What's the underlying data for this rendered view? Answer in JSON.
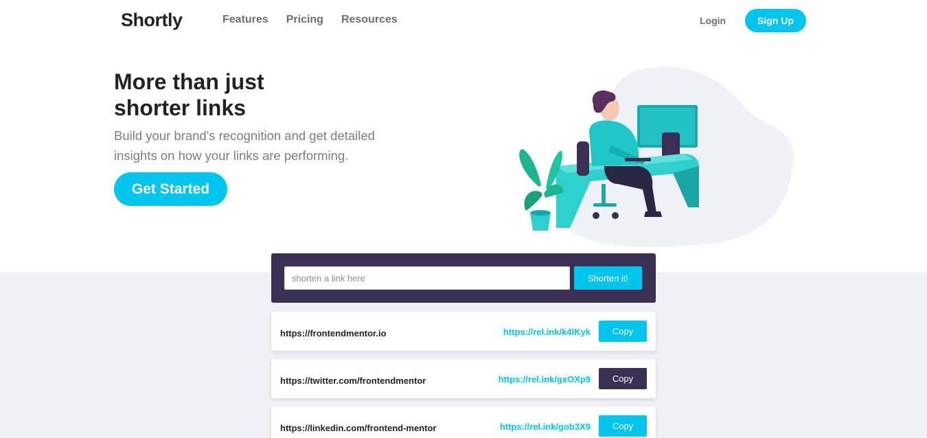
{
  "brand": {
    "name": "Shortly"
  },
  "nav": {
    "items": [
      "Features",
      "Pricing",
      "Resources"
    ]
  },
  "auth": {
    "login_label": "Login",
    "signup_label": "Sign Up"
  },
  "hero": {
    "title_line1": "More than just",
    "title_line2": "shorter links",
    "subtitle_line1": "Build your brand's recognition and get detailed",
    "subtitle_line2": "insights on how your links are performing.",
    "cta_label": "Get Started"
  },
  "shorten": {
    "placeholder": "shorten a link here",
    "button_label": "Shorten it!"
  },
  "results": [
    {
      "original": "https://frontendmentor.io",
      "short": "https://rel.ink/k4lKyk",
      "copy_label": "Copy",
      "copied": false
    },
    {
      "original": "https://twitter.com/frontendmentor",
      "short": "https://rel.ink/gxOXp9",
      "copy_label": "Copy",
      "copied": true
    },
    {
      "original": "https://linkedin.com/frontend-mentor",
      "short": "https://rel.ink/gob3X9",
      "copy_label": "Copy",
      "copied": false
    }
  ],
  "colors": {
    "accent": "#00c6ee",
    "dark_violet": "#3b3054",
    "text_dark": "#232127",
    "text_gray": "#9e9aa7",
    "section_bg": "#f0f1f6"
  },
  "illustration": {
    "icon": "person-working-at-desk-illustration"
  }
}
